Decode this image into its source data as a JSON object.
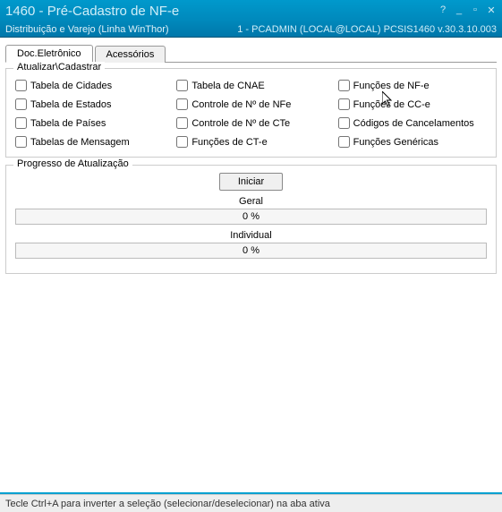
{
  "window": {
    "title": "1460 - Pré-Cadastro de NF-e",
    "subtitle_left": "Distribuição e Varejo (Linha WinThor)",
    "subtitle_right": "1 - PCADMIN (LOCAL@LOCAL)   PCSIS1460   v.30.3.10.003"
  },
  "tabs": [
    {
      "label": "Doc.Eletrônico",
      "active": true
    },
    {
      "label": "Acessórios",
      "active": false
    }
  ],
  "group_legend": "Atualizar\\Cadastrar",
  "checkboxes": {
    "col1": [
      "Tabela de Cidades",
      "Tabela de Estados",
      "Tabela de Países",
      "Tabelas de Mensagem"
    ],
    "col2": [
      "Tabela de CNAE",
      "Controle de Nº de NFe",
      "Controle de Nº de CTe",
      "Funções de CT-e"
    ],
    "col3": [
      "Funções de NF-e",
      "Funções de CC-e",
      "Códigos de Cancelamentos",
      "Funções Genéricas"
    ]
  },
  "progress": {
    "section_title": "Progresso de Atualização",
    "button": "Iniciar",
    "general_label": "Geral",
    "general_value": "0 %",
    "individual_label": "Individual",
    "individual_value": "0 %"
  },
  "statusbar": "Tecle Ctrl+A para inverter a seleção (selecionar/deselecionar) na aba ativa"
}
